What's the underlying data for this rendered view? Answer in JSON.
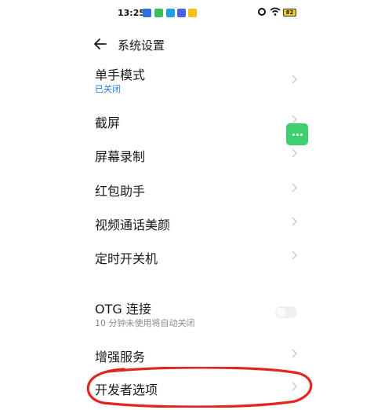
{
  "status_bar": {
    "time": "13:25",
    "battery": "82"
  },
  "header": {
    "title": "系统设置"
  },
  "items": [
    {
      "title": "单手模式",
      "subtitle": "已关闭"
    },
    {
      "title": "截屏"
    },
    {
      "title": "屏幕录制"
    },
    {
      "title": "红包助手"
    },
    {
      "title": "视频通话美颜"
    },
    {
      "title": "定时开关机"
    },
    {
      "title": "OTG 连接",
      "subtitle": "10 分钟未使用将自动关闭",
      "toggle_on": false
    },
    {
      "title": "增强服务"
    },
    {
      "title": "开发者选项"
    }
  ],
  "colors": {
    "accent": "#1f7ae0",
    "floating_button": "#3ecf6f",
    "annotation": "#e0261f"
  },
  "icons": [
    "back-arrow-icon",
    "chevron-right-icon",
    "more-dots-icon",
    "alarm-icon",
    "wifi-icon"
  ]
}
